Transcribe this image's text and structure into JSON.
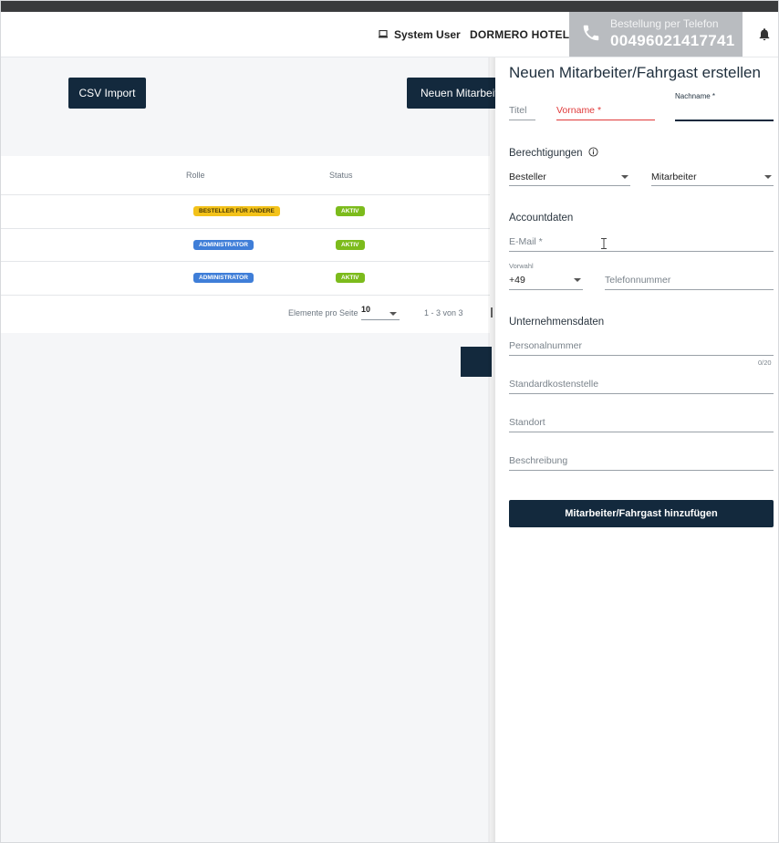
{
  "header": {
    "user_label": "System User",
    "hotel_label": "DORMERO HOTEL",
    "phone_label": "Bestellung per Telefon",
    "phone_number": "00496021417741",
    "icons": [
      "laptop-icon",
      "phone-icon",
      "bell-icon"
    ]
  },
  "toolbar": {
    "csv_import": "CSV Import",
    "new_employee": "Neuen Mitarbeiter/Fahrgast"
  },
  "table": {
    "columns": [
      "Rolle",
      "Status"
    ],
    "rows": [
      {
        "role": "BESTELLER FÜR ANDERE",
        "status": "AKTIV"
      },
      {
        "role": "ADMINISTRATOR",
        "status": "AKTIV"
      },
      {
        "role": "ADMINISTRATOR",
        "status": "AKTIV"
      }
    ],
    "pagination": {
      "per_page_label": "Elemente pro Seite",
      "per_page_value": "10",
      "range": "1 - 3 von 3"
    }
  },
  "panel": {
    "title": "Neuen Mitarbeiter/Fahrgast erstellen",
    "titel_placeholder": "Titel",
    "vorname_label": "Vorname *",
    "nachname_label": "Nachname *",
    "berechtigungen_heading": "Berechtigungen",
    "permission_select_1": "Besteller",
    "permission_select_2": "Mitarbeiter",
    "account_heading": "Accountdaten",
    "email_label": "E-Mail *",
    "vorwahl_label": "Vorwahl",
    "vorwahl_value": "+49",
    "telefon_label": "Telefonnummer",
    "company_heading": "Unternehmensdaten",
    "personalnummer_label": "Personalnummer",
    "personalnummer_counter": "0/20",
    "kostenstelle_label": "Standardkostenstelle",
    "standort_label": "Standort",
    "beschreibung_label": "Beschreibung",
    "submit_label": "Mitarbeiter/Fahrgast hinzufügen"
  },
  "colors": {
    "primary_dark": "#13293d",
    "error_red": "#e03a3a",
    "badge_yellow": "#f3c21a",
    "badge_blue": "#3f7ed8",
    "badge_green": "#7cbb1c",
    "phone_box": "#b9bcc0"
  }
}
